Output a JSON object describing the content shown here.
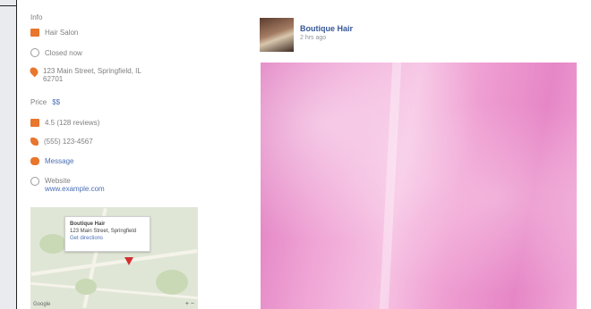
{
  "sidebar": {
    "section_title": "Info",
    "category": "Hair Salon",
    "hours_summary": "Closed now",
    "address_line1": "123 Main Street, Springfield, IL",
    "address_line2": "62701",
    "price_label": "Price",
    "price_value": "$$",
    "reviews": "4.5 (128 reviews)",
    "phone": "(555) 123-4567",
    "message": "Message",
    "website_label": "Website",
    "website_value": "www.example.com"
  },
  "map": {
    "popup_title": "Boutique Hair",
    "popup_line1": "123 Main Street, Springfield",
    "popup_line2": "Get directions",
    "google_label": "Google",
    "zoom": "+ −"
  },
  "post": {
    "author": "Boutique Hair",
    "time": "2 hrs ago"
  },
  "colors": {
    "accent": "#e8762d",
    "link": "#365899"
  }
}
